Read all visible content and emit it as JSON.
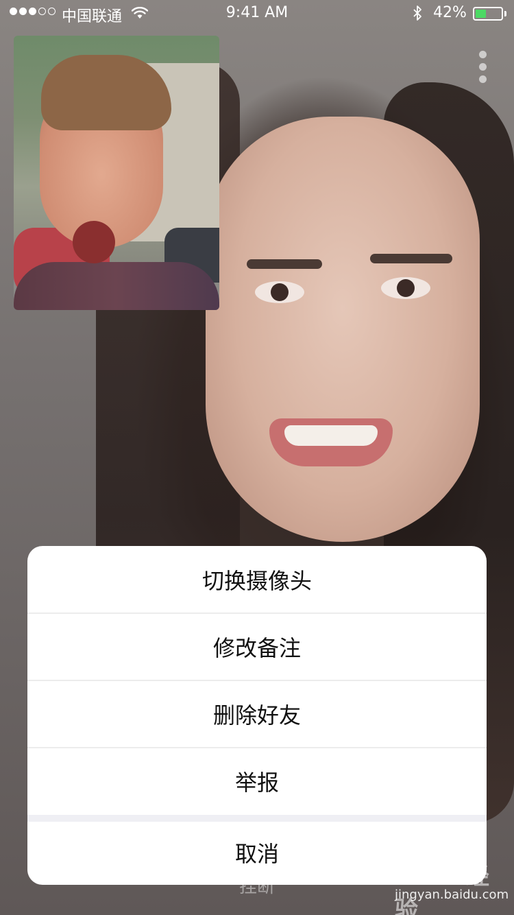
{
  "status_bar": {
    "carrier": "中国联通",
    "time": "9:41 AM",
    "battery_percent": "42%",
    "battery_level": 0.42,
    "signal_bars_filled": 3,
    "signal_bars_total": 5,
    "icons": [
      "signal-dots-icon",
      "wifi-icon",
      "bluetooth-icon",
      "battery-icon"
    ]
  },
  "call": {
    "hangup_label": "挂断",
    "more_icon": "more-vertical-icon"
  },
  "action_sheet": {
    "items": [
      "切换摄像头",
      "修改备注",
      "删除好友",
      "举报"
    ],
    "cancel_label": "取消"
  },
  "watermark": {
    "logo_text": "Baidu经验",
    "url": "jingyan.baidu.com"
  },
  "colors": {
    "battery_fill": "#4cd964",
    "sheet_background": "#ffffff",
    "sheet_separator": "#efeff4"
  }
}
